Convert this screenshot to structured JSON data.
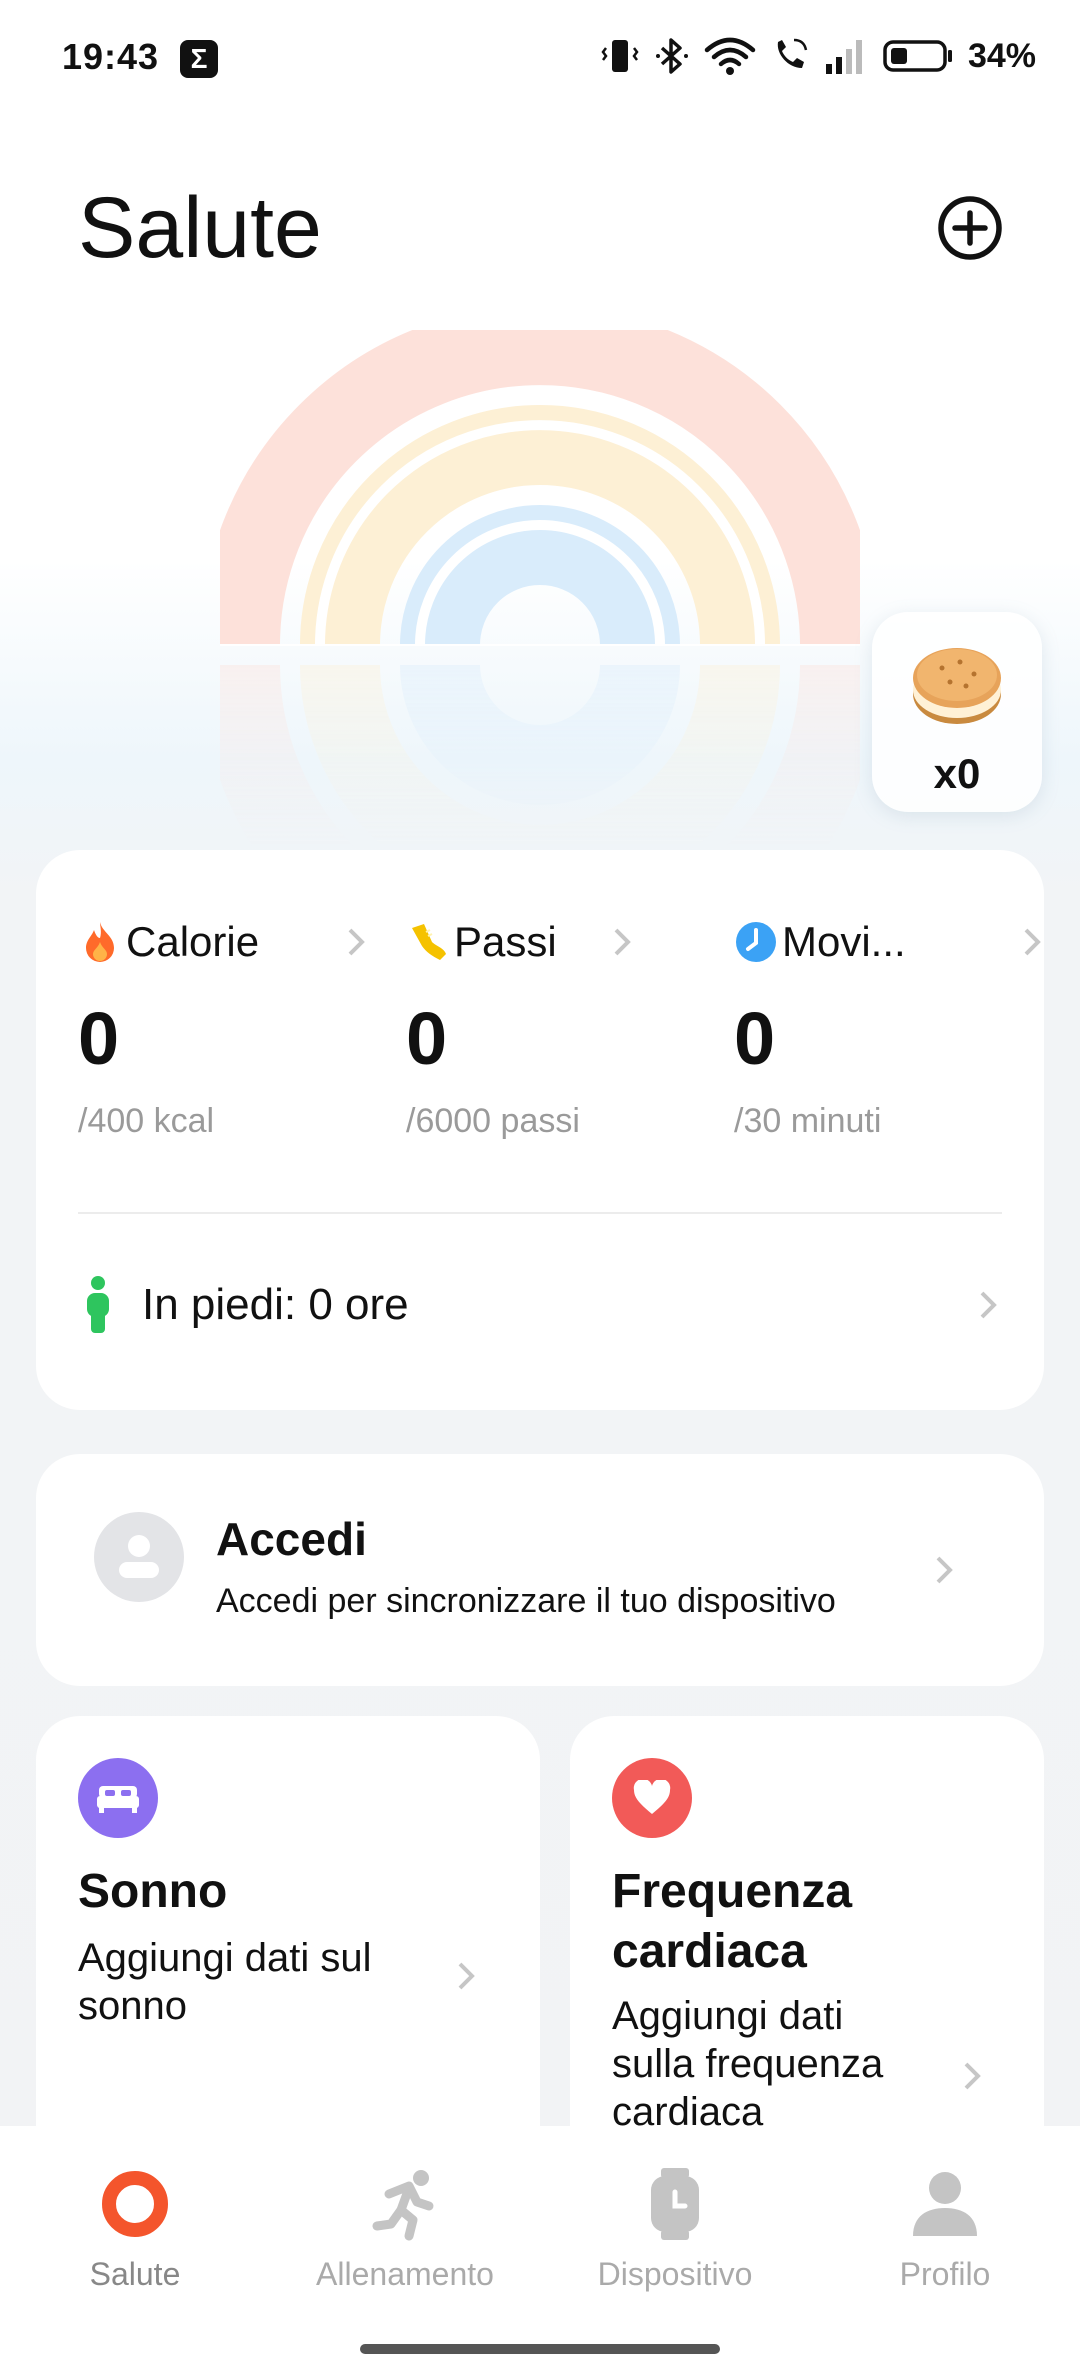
{
  "status_bar": {
    "time": "19:43",
    "app_badge": "Σ",
    "battery_percent": "34%",
    "battery_level": 0.34
  },
  "header": {
    "title": "Salute"
  },
  "rewards": {
    "count": "x0"
  },
  "activity": {
    "metrics": [
      {
        "label": "Calorie",
        "value": "0",
        "goal": "/400 kcal",
        "icon": "flame-icon",
        "color": "#ff6a2a"
      },
      {
        "label": "Passi",
        "value": "0",
        "goal": "/6000 passi",
        "icon": "shoe-icon",
        "color": "#f5c200"
      },
      {
        "label": "Movi...",
        "value": "0",
        "goal": "/30 minuti",
        "icon": "clock-icon",
        "color": "#3ba2f5"
      }
    ],
    "standing": "In piedi: 0 ore"
  },
  "login": {
    "title": "Accedi",
    "subtitle": "Accedi per sincronizzare il tuo dispositivo"
  },
  "sleep": {
    "title": "Sonno",
    "subtitle_line1": "Aggiungi dati sul",
    "subtitle_line2": "sonno",
    "icon_color": "#8c6ff0"
  },
  "heart_rate": {
    "title_line1": "Frequenza",
    "title_line2": "cardiaca",
    "subtitle_line1": "Aggiungi dati",
    "subtitle_line2": "sulla frequenza",
    "subtitle_line3": "cardiaca",
    "icon_color": "#f25a58"
  },
  "nav": {
    "items": [
      {
        "label": "Salute",
        "icon": "health-ring-icon",
        "active": true
      },
      {
        "label": "Allenamento",
        "icon": "running-icon",
        "active": false
      },
      {
        "label": "Dispositivo",
        "icon": "watch-icon",
        "active": false
      },
      {
        "label": "Profilo",
        "icon": "person-icon",
        "active": false
      }
    ],
    "accent": "#f4552c"
  },
  "rainbow_colors": {
    "outer": "#fde1da",
    "middle": "#fdf0d5",
    "inner": "#d9ecfb"
  }
}
